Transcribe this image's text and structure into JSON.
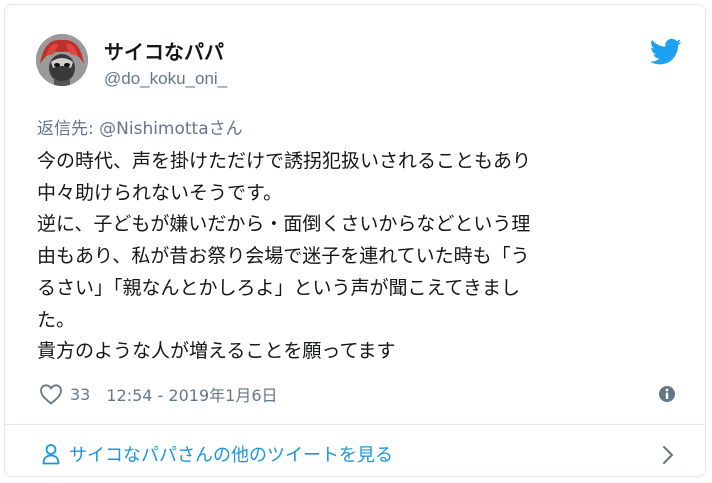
{
  "user": {
    "display_name": "サイコなパパ",
    "handle": "@do_koku_oni_"
  },
  "reply": {
    "prefix": "返信先: ",
    "mention": "@Nishimotta",
    "suffix": "さん"
  },
  "tweet": {
    "lines": [
      "今の時代、声を掛けただけで誘拐犯扱いされることもあり",
      "中々助けられないそうです。",
      "逆に、子どもが嫌いだから・面倒くさいからなどという理",
      "由もあり、私が昔お祭り会場で迷子を連れていた時も「う",
      "るさい」「親なんとかしろよ」という声が聞こえてきまし",
      "た。",
      "貴方のような人が増えることを願ってます"
    ]
  },
  "meta": {
    "like_count": "33",
    "timestamp": "12:54 - 2019年1月6日"
  },
  "footer": {
    "more_tweets_label": "サイコなパパさんの他のツイートを見る"
  },
  "icons": {
    "brand": "twitter-bird-icon",
    "like": "heart-icon",
    "info": "info-icon",
    "person": "person-icon",
    "chevron": "chevron-right-icon"
  },
  "colors": {
    "twitter_blue": "#1da1f2",
    "link_blue": "#1b95e0",
    "secondary_text": "#657786",
    "primary_text": "#14171a",
    "border": "#e1e8ed"
  }
}
